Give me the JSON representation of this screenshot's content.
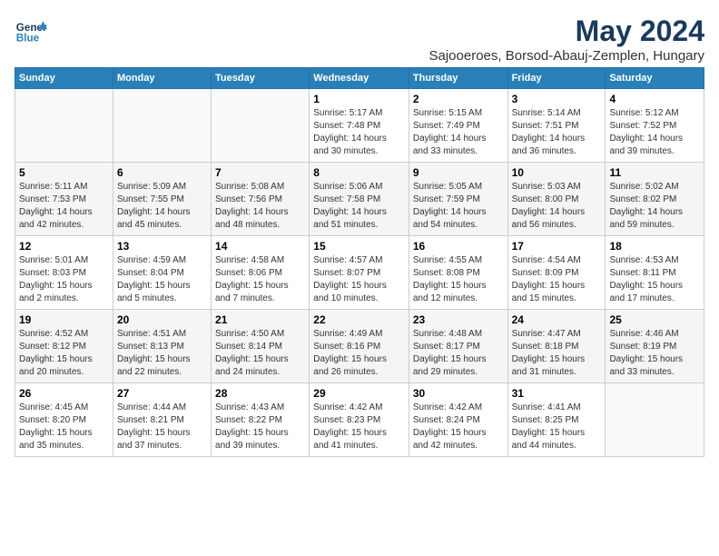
{
  "header": {
    "logo_line1": "General",
    "logo_line2": "Blue",
    "month": "May 2024",
    "location": "Sajooeroes, Borsod-Abauj-Zemplen, Hungary"
  },
  "weekdays": [
    "Sunday",
    "Monday",
    "Tuesday",
    "Wednesday",
    "Thursday",
    "Friday",
    "Saturday"
  ],
  "weeks": [
    [
      {
        "day": "",
        "info": ""
      },
      {
        "day": "",
        "info": ""
      },
      {
        "day": "",
        "info": ""
      },
      {
        "day": "1",
        "info": "Sunrise: 5:17 AM\nSunset: 7:48 PM\nDaylight: 14 hours\nand 30 minutes."
      },
      {
        "day": "2",
        "info": "Sunrise: 5:15 AM\nSunset: 7:49 PM\nDaylight: 14 hours\nand 33 minutes."
      },
      {
        "day": "3",
        "info": "Sunrise: 5:14 AM\nSunset: 7:51 PM\nDaylight: 14 hours\nand 36 minutes."
      },
      {
        "day": "4",
        "info": "Sunrise: 5:12 AM\nSunset: 7:52 PM\nDaylight: 14 hours\nand 39 minutes."
      }
    ],
    [
      {
        "day": "5",
        "info": "Sunrise: 5:11 AM\nSunset: 7:53 PM\nDaylight: 14 hours\nand 42 minutes."
      },
      {
        "day": "6",
        "info": "Sunrise: 5:09 AM\nSunset: 7:55 PM\nDaylight: 14 hours\nand 45 minutes."
      },
      {
        "day": "7",
        "info": "Sunrise: 5:08 AM\nSunset: 7:56 PM\nDaylight: 14 hours\nand 48 minutes."
      },
      {
        "day": "8",
        "info": "Sunrise: 5:06 AM\nSunset: 7:58 PM\nDaylight: 14 hours\nand 51 minutes."
      },
      {
        "day": "9",
        "info": "Sunrise: 5:05 AM\nSunset: 7:59 PM\nDaylight: 14 hours\nand 54 minutes."
      },
      {
        "day": "10",
        "info": "Sunrise: 5:03 AM\nSunset: 8:00 PM\nDaylight: 14 hours\nand 56 minutes."
      },
      {
        "day": "11",
        "info": "Sunrise: 5:02 AM\nSunset: 8:02 PM\nDaylight: 14 hours\nand 59 minutes."
      }
    ],
    [
      {
        "day": "12",
        "info": "Sunrise: 5:01 AM\nSunset: 8:03 PM\nDaylight: 15 hours\nand 2 minutes."
      },
      {
        "day": "13",
        "info": "Sunrise: 4:59 AM\nSunset: 8:04 PM\nDaylight: 15 hours\nand 5 minutes."
      },
      {
        "day": "14",
        "info": "Sunrise: 4:58 AM\nSunset: 8:06 PM\nDaylight: 15 hours\nand 7 minutes."
      },
      {
        "day": "15",
        "info": "Sunrise: 4:57 AM\nSunset: 8:07 PM\nDaylight: 15 hours\nand 10 minutes."
      },
      {
        "day": "16",
        "info": "Sunrise: 4:55 AM\nSunset: 8:08 PM\nDaylight: 15 hours\nand 12 minutes."
      },
      {
        "day": "17",
        "info": "Sunrise: 4:54 AM\nSunset: 8:09 PM\nDaylight: 15 hours\nand 15 minutes."
      },
      {
        "day": "18",
        "info": "Sunrise: 4:53 AM\nSunset: 8:11 PM\nDaylight: 15 hours\nand 17 minutes."
      }
    ],
    [
      {
        "day": "19",
        "info": "Sunrise: 4:52 AM\nSunset: 8:12 PM\nDaylight: 15 hours\nand 20 minutes."
      },
      {
        "day": "20",
        "info": "Sunrise: 4:51 AM\nSunset: 8:13 PM\nDaylight: 15 hours\nand 22 minutes."
      },
      {
        "day": "21",
        "info": "Sunrise: 4:50 AM\nSunset: 8:14 PM\nDaylight: 15 hours\nand 24 minutes."
      },
      {
        "day": "22",
        "info": "Sunrise: 4:49 AM\nSunset: 8:16 PM\nDaylight: 15 hours\nand 26 minutes."
      },
      {
        "day": "23",
        "info": "Sunrise: 4:48 AM\nSunset: 8:17 PM\nDaylight: 15 hours\nand 29 minutes."
      },
      {
        "day": "24",
        "info": "Sunrise: 4:47 AM\nSunset: 8:18 PM\nDaylight: 15 hours\nand 31 minutes."
      },
      {
        "day": "25",
        "info": "Sunrise: 4:46 AM\nSunset: 8:19 PM\nDaylight: 15 hours\nand 33 minutes."
      }
    ],
    [
      {
        "day": "26",
        "info": "Sunrise: 4:45 AM\nSunset: 8:20 PM\nDaylight: 15 hours\nand 35 minutes."
      },
      {
        "day": "27",
        "info": "Sunrise: 4:44 AM\nSunset: 8:21 PM\nDaylight: 15 hours\nand 37 minutes."
      },
      {
        "day": "28",
        "info": "Sunrise: 4:43 AM\nSunset: 8:22 PM\nDaylight: 15 hours\nand 39 minutes."
      },
      {
        "day": "29",
        "info": "Sunrise: 4:42 AM\nSunset: 8:23 PM\nDaylight: 15 hours\nand 41 minutes."
      },
      {
        "day": "30",
        "info": "Sunrise: 4:42 AM\nSunset: 8:24 PM\nDaylight: 15 hours\nand 42 minutes."
      },
      {
        "day": "31",
        "info": "Sunrise: 4:41 AM\nSunset: 8:25 PM\nDaylight: 15 hours\nand 44 minutes."
      },
      {
        "day": "",
        "info": ""
      }
    ]
  ]
}
